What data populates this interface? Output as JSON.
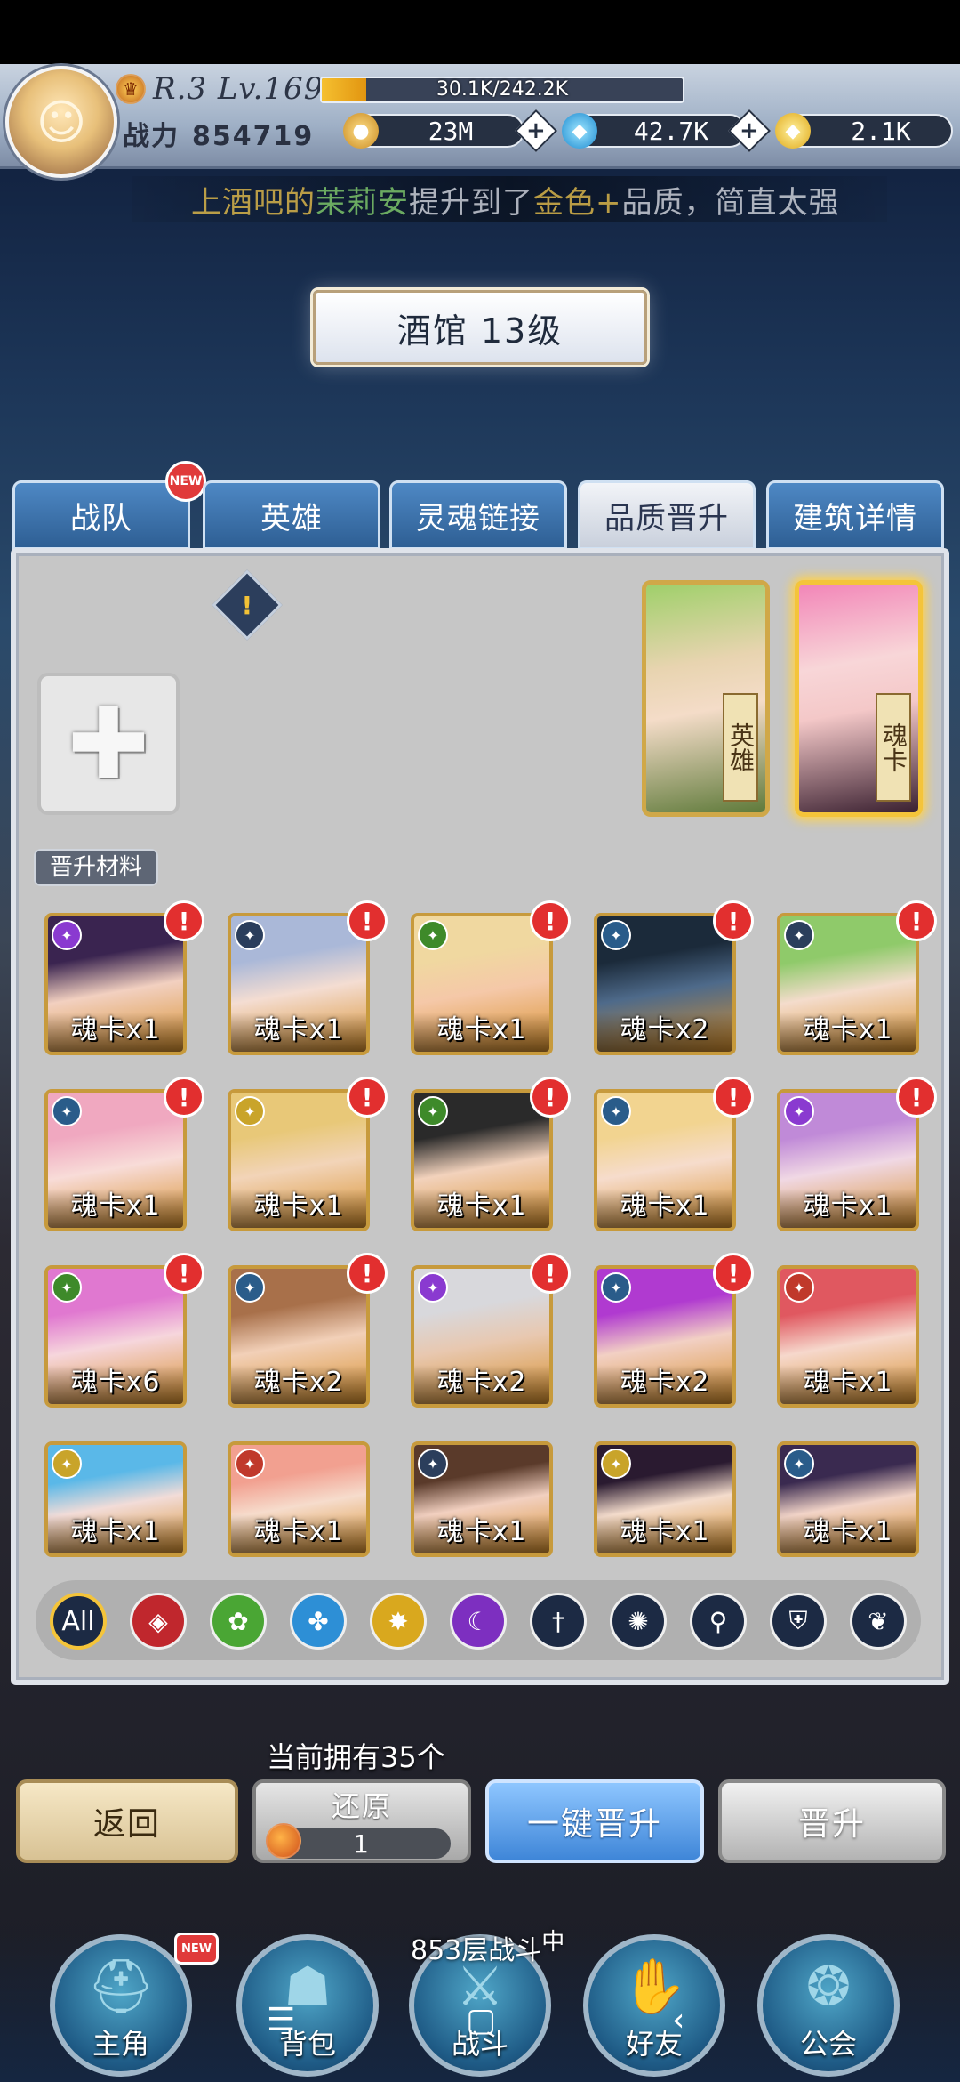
{
  "player": {
    "rank": "R.3 Lv.169",
    "exp_text": "30.1K/242.2K",
    "exp_progress": 0.124,
    "power_label": "战力",
    "power_value": "854719"
  },
  "currencies": [
    {
      "icon": "gold-coin-icon",
      "value": "23M",
      "color": "#e6b24a"
    },
    {
      "icon": "diamond-gem-icon",
      "value": "42.7K",
      "color": "#3fb6e8"
    },
    {
      "icon": "gold-ticket-icon",
      "value": "2.1K",
      "color": "#f2c540"
    }
  ],
  "marquee": {
    "pre": "上酒吧的",
    "name": "茉莉安",
    "mid": "提升到了",
    "quality": "金色+",
    "post": "品质，简直太强"
  },
  "title": "酒馆 13级",
  "tabs": [
    {
      "label": "战队",
      "new": "NEW"
    },
    {
      "label": "英雄"
    },
    {
      "label": "灵魂链接"
    },
    {
      "label": "品质晋升"
    },
    {
      "label": "建筑详情"
    }
  ],
  "slots": {
    "hero_label": "英雄",
    "soulcard_label": "魂卡"
  },
  "materials_label": "晋升材料",
  "materials": [
    {
      "label": "魂卡x1",
      "alert": "!",
      "class_color": "#8a3ad0",
      "art": [
        "#3a2450",
        "#f2d0c0"
      ]
    },
    {
      "label": "魂卡x1",
      "alert": "!",
      "class_color": "#2b3e5c",
      "art": [
        "#aab8d8",
        "#f4ddd2"
      ]
    },
    {
      "label": "魂卡x1",
      "alert": "!",
      "class_color": "#3e8a2a",
      "art": [
        "#f0d8a0",
        "#f5c8a8"
      ]
    },
    {
      "label": "魂卡x2",
      "alert": "!",
      "class_color": "#2a5c8a",
      "art": [
        "#1b2a3a",
        "#4e6a8a"
      ]
    },
    {
      "label": "魂卡x1",
      "alert": "!",
      "class_color": "#2b3e5c",
      "art": [
        "#8fca6a",
        "#f4dccc"
      ]
    },
    {
      "label": "魂卡x1",
      "alert": "!",
      "class_color": "#2a5c8a",
      "art": [
        "#f0a8c0",
        "#f8dcd8"
      ]
    },
    {
      "label": "魂卡x1",
      "alert": "!",
      "class_color": "#c9a42a",
      "art": [
        "#e8c878",
        "#f2d4b8"
      ]
    },
    {
      "label": "魂卡x1",
      "alert": "!",
      "class_color": "#3e8a2a",
      "art": [
        "#2a2a2a",
        "#f2d2bc"
      ]
    },
    {
      "label": "魂卡x1",
      "alert": "!",
      "class_color": "#2a5c8a",
      "art": [
        "#f2d490",
        "#f6dccc"
      ]
    },
    {
      "label": "魂卡x1",
      "alert": "!",
      "class_color": "#8a3ad0",
      "art": [
        "#c08ad8",
        "#f0d8e4"
      ]
    },
    {
      "label": "魂卡x6",
      "alert": "!",
      "class_color": "#3e8a2a",
      "art": [
        "#e078d0",
        "#f6d6dc"
      ]
    },
    {
      "label": "魂卡x2",
      "alert": "!",
      "class_color": "#2a5c8a",
      "art": [
        "#a8704a",
        "#f2d0b8"
      ]
    },
    {
      "label": "魂卡x2",
      "alert": "!",
      "class_color": "#8a3ad0",
      "art": [
        "#d8d8dc",
        "#e8c8b0"
      ]
    },
    {
      "label": "魂卡x2",
      "alert": "!",
      "class_color": "#2a5c8a",
      "art": [
        "#b03ad0",
        "#f2d0c4"
      ]
    },
    {
      "label": "魂卡x1",
      "class_color": "#c0392b",
      "art": [
        "#e05860",
        "#f6d8cc"
      ]
    },
    {
      "label": "魂卡x1",
      "class_color": "#c9a42a",
      "art": [
        "#5ab8e8",
        "#f2dcd8"
      ]
    },
    {
      "label": "魂卡x1",
      "class_color": "#c0392b",
      "art": [
        "#f2a090",
        "#f6dccc"
      ]
    },
    {
      "label": "魂卡x1",
      "class_color": "#2b3e5c",
      "art": [
        "#5a3a2a",
        "#f2d0c0"
      ]
    },
    {
      "label": "魂卡x1",
      "class_color": "#c9a42a",
      "art": [
        "#2a1a30",
        "#f4dccc"
      ]
    },
    {
      "label": "魂卡x1",
      "class_color": "#2a5c8a",
      "art": [
        "#3a2a50",
        "#f2d4c8"
      ]
    }
  ],
  "filters": [
    {
      "label": "All",
      "name": "filter-all",
      "bg": "#1c2a44"
    },
    {
      "label": "◈",
      "name": "filter-fire-icon",
      "bg": "#c0272d"
    },
    {
      "label": "✿",
      "name": "filter-nature-icon",
      "bg": "#4aa634"
    },
    {
      "label": "✤",
      "name": "filter-water-icon",
      "bg": "#2d8fd6"
    },
    {
      "label": "✸",
      "name": "filter-light-icon",
      "bg": "#d9a81e"
    },
    {
      "label": "☾",
      "name": "filter-dark-icon",
      "bg": "#7d2fc0"
    },
    {
      "label": "†",
      "name": "filter-sword-icon",
      "bg": "#1c2a44"
    },
    {
      "label": "✺",
      "name": "filter-shuriken-icon",
      "bg": "#1c2a44"
    },
    {
      "label": "⚲",
      "name": "filter-staff-icon",
      "bg": "#1c2a44"
    },
    {
      "label": "⛨",
      "name": "filter-shield-icon",
      "bg": "#1c2a44"
    },
    {
      "label": "❦",
      "name": "filter-wing-icon",
      "bg": "#1c2a44"
    }
  ],
  "owned_text": "当前拥有35个",
  "buttons": {
    "back": "返回",
    "restore": "还原",
    "restore_count": "1",
    "auto_promote": "一键晋升",
    "promote": "晋升"
  },
  "bottom_nav": [
    {
      "label": "主角",
      "icon": "helmet-icon",
      "new": "NEW"
    },
    {
      "label": "背包",
      "icon": "backpack-icon"
    },
    {
      "label": "战斗",
      "icon": "swords-icon"
    },
    {
      "label": "好友",
      "icon": "handshake-icon"
    },
    {
      "label": "公会",
      "icon": "guild-crest-icon"
    }
  ],
  "battle_status": "853层战斗",
  "battle_status_sup": "中"
}
